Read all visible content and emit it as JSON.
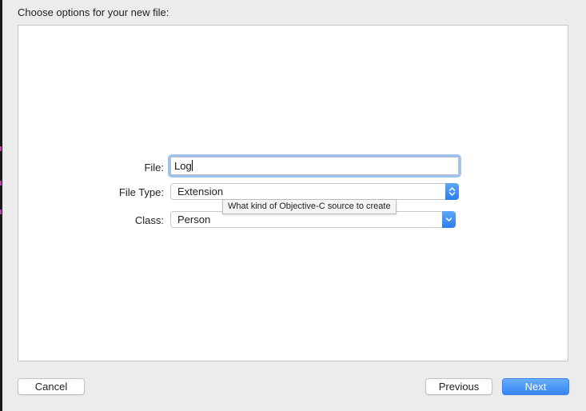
{
  "dialog": {
    "heading": "Choose options for your new file:"
  },
  "form": {
    "file": {
      "label": "File:",
      "value": "Log"
    },
    "file_type": {
      "label": "File Type:",
      "value": "Extension"
    },
    "class": {
      "label": "Class:",
      "value": "Person"
    },
    "tooltip": "What kind of Objective-C source to create"
  },
  "buttons": {
    "cancel": "Cancel",
    "previous": "Previous",
    "next": "Next"
  },
  "colors": {
    "accent": "#3685f5",
    "focus_ring": "#9cc3f2",
    "sheet_bg": "#ececec"
  },
  "icons": {
    "file_type_control": "stepper-arrows-icon",
    "class_control": "chevron-down-icon"
  }
}
